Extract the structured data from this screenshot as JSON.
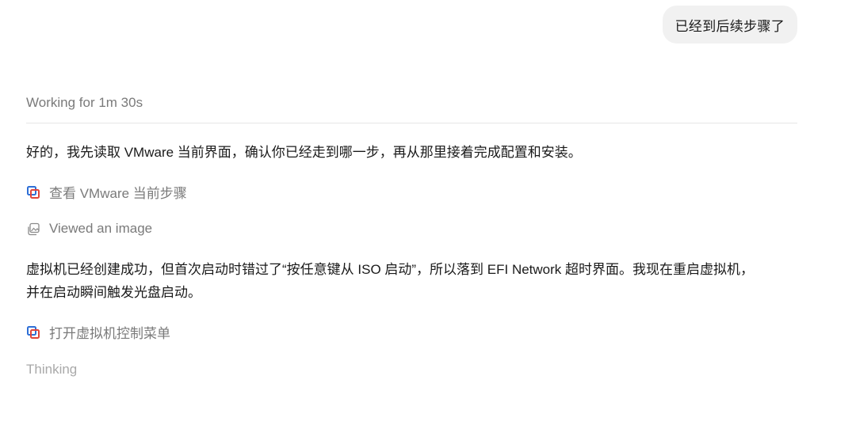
{
  "user_message": "已经到后续步骤了",
  "working_status": "Working for 1m 30s",
  "assistant": {
    "paragraph_1": "好的，我先读取 VMware 当前界面，确认你已经走到哪一步，再从那里接着完成配置和安装。",
    "step_1": "查看 VMware 当前步骤",
    "step_2": "Viewed an image",
    "paragraph_2_line_1": "虚拟机已经创建成功，但首次启动时错过了“按任意键从 ISO 启动”，所以落到 EFI Network 超时界面。我现在重启虚拟机，",
    "paragraph_2_line_2": "并在启动瞬间触发光盘启动。",
    "step_3": "打开虚拟机控制菜单",
    "thinking": "Thinking"
  },
  "icons": {
    "step_1": "vmware-icon",
    "step_2": "image-icon",
    "step_3": "vmware-icon"
  },
  "colors": {
    "vmware_blue": "#2f6fd6",
    "vmware_red": "#e0453a",
    "muted_text": "#7a7a7a",
    "thinking_text": "#a9a9a9"
  }
}
